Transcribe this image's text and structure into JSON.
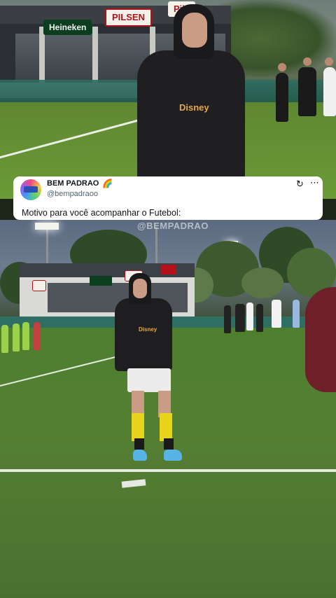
{
  "top_video": {
    "sponsors": [
      "Heineken",
      "PILSEN",
      "Pils"
    ],
    "hoodie_logo": "Disney"
  },
  "tweet": {
    "display_name": "BEM PADRAO",
    "name_emoji": "🌈",
    "handle": "@bempadraoo",
    "text": "Motivo para você acompanhar o Futebol:",
    "icons": [
      "avatar",
      "rainbow-icon",
      "sync-icon",
      "more-icon"
    ]
  },
  "bottom_video": {
    "watermark": "@BEMPADRAO"
  },
  "colors": {
    "card_bg": "#ffffff",
    "text_primary": "#0f1419",
    "text_secondary": "#536471",
    "grass": "#557f33",
    "sock_yellow": "#e9d41c",
    "shoe_blue": "#58b3e6"
  }
}
